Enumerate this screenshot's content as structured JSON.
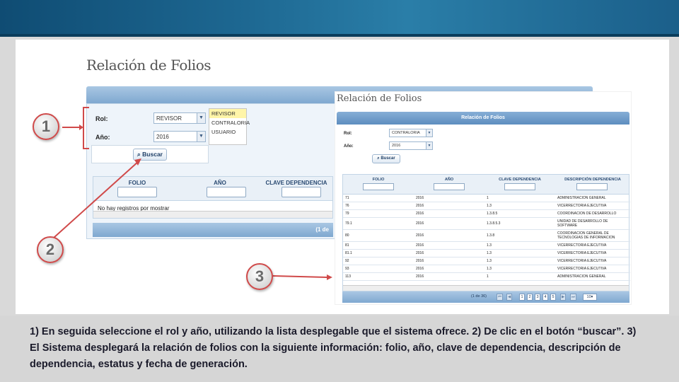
{
  "shot1": {
    "title": "Relación de Folios",
    "rol_label": "Rol:",
    "rol_value": "REVISOR",
    "anio_label": "Año:",
    "anio_value": "2016",
    "dropdown_options": [
      "REVISOR",
      "CONTRALORIA",
      "USUARIO"
    ],
    "buscar_label": "Buscar",
    "columns": [
      "FOLIO",
      "AÑO",
      "CLAVE DEPENDENCIA"
    ],
    "empty_text": "No hay registros por mostrar",
    "pager_text": "(1 de"
  },
  "shot2": {
    "title": "Relación de Folios",
    "panel_title": "Relación de Folios",
    "rol_label": "Rol:",
    "rol_value": "CONTRALORIA",
    "anio_label": "Año:",
    "anio_value": "2016",
    "buscar_label": "Buscar",
    "columns": [
      "FOLIO",
      "AÑO",
      "CLAVE DEPENDENCIA",
      "DESCRIPCIÓN DEPENDENCIA"
    ],
    "rows": [
      [
        "71",
        "2016",
        "1",
        "ADMINISTRACION GENERAL"
      ],
      [
        "76",
        "2016",
        "1.3",
        "VICERRECTORIA EJECUTIVA"
      ],
      [
        "79",
        "2016",
        "1.3.8.5",
        "COORDINACION DE DESARROLLO"
      ],
      [
        "79.1",
        "2016",
        "1.3.8.5.3",
        "UNIDAD DE DESARROLLO DE SOFTWARE"
      ],
      [
        "80",
        "2016",
        "1.3.8",
        "COORDINACION GENERAL DE TECNOLOGIAS DE INFORMACION"
      ],
      [
        "81",
        "2016",
        "1.3",
        "VICERRECTORIA EJECUTIVA"
      ],
      [
        "81.1",
        "2016",
        "1.3",
        "VICERRECTORIA EJECUTIVA"
      ],
      [
        "92",
        "2016",
        "1.3",
        "VICERRECTORIA EJECUTIVA"
      ],
      [
        "93",
        "2016",
        "1.3",
        "VICERRECTORIA EJECUTIVA"
      ],
      [
        "113",
        "2016",
        "1",
        "ADMINISTRACION GENERAL"
      ]
    ],
    "pager_text": "(1 de 36)",
    "pages": [
      "1",
      "2",
      "3",
      "4",
      "5"
    ],
    "page_size": "10"
  },
  "callouts": [
    "1",
    "2",
    "3"
  ],
  "caption": "1) En seguida seleccione el rol  y  año, utilizando la lista desplegable que el sistema ofrece. 2) De clic en el botón “buscar”.  3) El Sistema desplegará la relación de folios con la siguiente información: folio, año, clave de dependencia, descripción de dependencia, estatus y fecha de generación.",
  "colors": {
    "accent_red": "#d04a4a",
    "header_blue": "#7fa8d0",
    "top_band": "#1d6791"
  }
}
